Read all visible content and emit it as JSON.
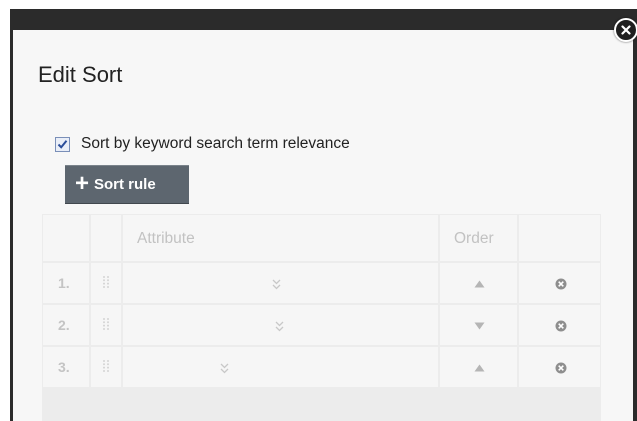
{
  "dialog": {
    "title": "Edit Sort",
    "close_icon": "close-circle-icon"
  },
  "keyword_sort": {
    "label": "Sort by keyword search term relevance",
    "checked": true
  },
  "add_rule_button": {
    "icon": "plus-icon",
    "label": "Sort rule"
  },
  "table": {
    "headers": {
      "number": "",
      "handle": "",
      "attribute": "Attribute",
      "order": "Order",
      "actions": ""
    },
    "rows": [
      {
        "number": "1.",
        "attribute": "",
        "order": "ascending",
        "order_icon": "triangle-up-icon"
      },
      {
        "number": "2.",
        "attribute": "",
        "order": "descending",
        "order_icon": "triangle-down-icon"
      },
      {
        "number": "3.",
        "attribute": "",
        "order": "ascending",
        "order_icon": "triangle-up-icon"
      }
    ]
  },
  "colors": {
    "frame": "#2b2b2b",
    "dialog_bg": "#f7f7f7",
    "button_bg": "#5d666f",
    "table_text": "#c2c2c2",
    "checkbox_check": "#2a4d9a"
  }
}
